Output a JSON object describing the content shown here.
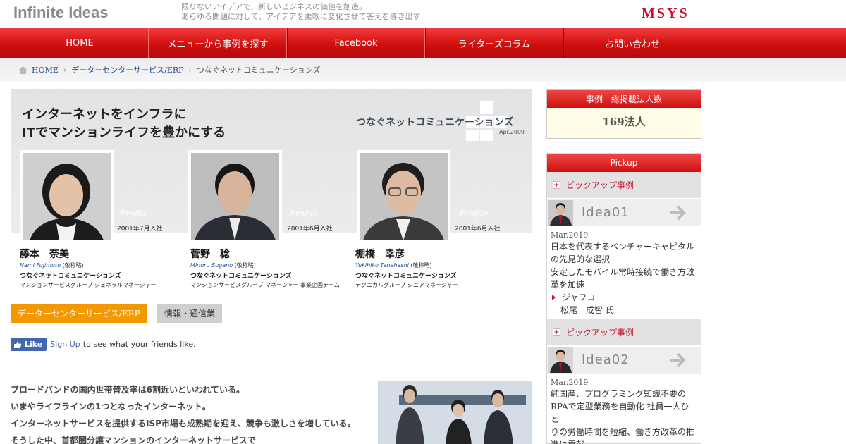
{
  "header": {
    "logo": "Infinite Ideas",
    "tagline_1": "限りないアイデアで、新しいビジネスの価値を創造。",
    "tagline_2": "あらゆる問題に対して、アイデアを柔軟に変化させて答えを導き出す",
    "brand": "MSYS"
  },
  "nav": {
    "items": [
      "HOME",
      "メニューから事例を探す",
      "Facebook",
      "ライターズコラム",
      "お問い合わせ"
    ]
  },
  "breadcrumb": {
    "home": "HOME",
    "category": "データーセンターサービス/ERP",
    "current": "つなぐネットコミュニケーションズ"
  },
  "banner": {
    "title_1": "インターネットをインフラに",
    "title_2": "ITでマンションライフを豊かにする",
    "company": "つなぐネットコミュニケーションズ",
    "date": "Apr.2009",
    "profile_label": "Profile"
  },
  "staff": [
    {
      "name": "藤本　奈美",
      "romaji": "Nami  Fujimoto",
      "honorific": "(敬称略)",
      "joined": "2001年7月入社",
      "company": "つなぐネットコミュニケーションズ",
      "role": "マンションサービスグループ ジェネラルマネージャー"
    },
    {
      "name": "菅野　稔",
      "romaji": "Minoru  Sugano",
      "honorific": "(敬称略)",
      "joined": "2001年6月入社",
      "company": "つなぐネットコミュニケーションズ",
      "role": "マンションサービスグループ マネージャー 事業企画チーム"
    },
    {
      "name": "棚橋　幸彦",
      "romaji": "Yukihiko  Tanahashi",
      "honorific": "(敬称略)",
      "joined": "2001年6月入社",
      "company": "つなぐネットコミュニケーションズ",
      "role": "テクニカルグループ シニアマネージャー"
    }
  ],
  "tags": [
    "データーセンターサービス/ERP",
    "情報・通信業"
  ],
  "facebook": {
    "like": "Like",
    "signup": "Sign Up",
    "text": "to see what your friends like."
  },
  "article": {
    "lines": [
      "ブロードバンドの国内世帯普及率は6割近いといわれている。",
      "いまやライフラインの1つとなったインターネット。",
      "インターネットサービスを提供するISP市場も成熟期を迎え、競争も激しさを増している。",
      "そうした中、首都圏分譲マンションのインターネットサービスで"
    ]
  },
  "sidebar": {
    "count_header": "事例　総掲載法人数",
    "count_value": "169法人",
    "pickup_header": "Pickup",
    "pickups": [
      {
        "sub": "ピックアップ事例",
        "idea": "Idea01",
        "date": "Mar.2019",
        "lines": [
          "日本を代表するベンチャーキャピタル",
          "の先見的な選択",
          "安定したモバイル常時接続で働き方改",
          "革を加速"
        ],
        "company": "ジャフコ",
        "person": "松尾　成智 氏"
      },
      {
        "sub": "ピックアップ事例",
        "idea": "Idea02",
        "date": "Mar.2019",
        "lines": [
          "純国産、プログラミング知識不要の",
          "RPAで定型業務を自動化 社員一人ひと",
          "りの労働時間を短縮、働き方改革の推",
          "進に貢献"
        ]
      }
    ]
  }
}
